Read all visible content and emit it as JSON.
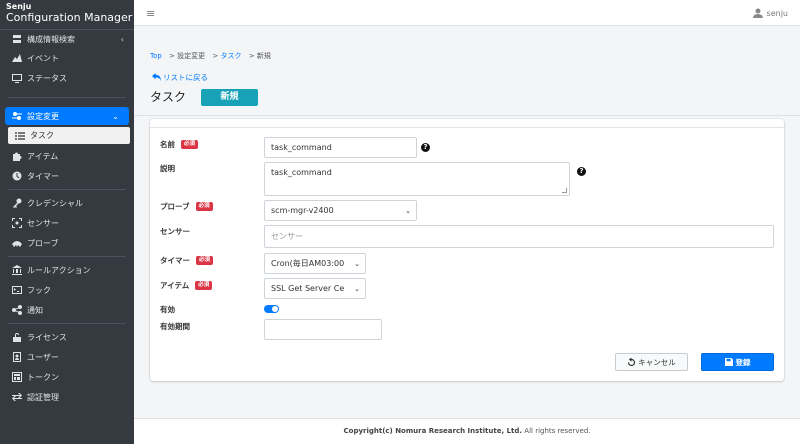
{
  "brand": {
    "line1": "Senju",
    "line2": "Configuration Manager"
  },
  "sidebar": {
    "items": [
      {
        "label": "構成情報検索",
        "icon": "server-icon",
        "caret": "‹"
      },
      {
        "label": "イベント",
        "icon": "chart-area-icon"
      },
      {
        "label": "ステータス",
        "icon": "monitor-icon"
      },
      {
        "label": "設定変更",
        "icon": "sliders-icon",
        "caret": "⌄"
      },
      {
        "label": "タスク",
        "icon": "list-icon"
      },
      {
        "label": "アイテム",
        "icon": "puzzle-icon"
      },
      {
        "label": "タイマー",
        "icon": "clock-icon"
      },
      {
        "label": "クレデンシャル",
        "icon": "key-icon"
      },
      {
        "label": "センサー",
        "icon": "scan-icon"
      },
      {
        "label": "プローブ",
        "icon": "probe-icon"
      },
      {
        "label": "ルールアクション",
        "icon": "bank-icon"
      },
      {
        "label": "フック",
        "icon": "terminal-icon"
      },
      {
        "label": "通知",
        "icon": "share-icon"
      },
      {
        "label": "ライセンス",
        "icon": "lock-open-icon"
      },
      {
        "label": "ユーザー",
        "icon": "user-book-icon"
      },
      {
        "label": "トークン",
        "icon": "token-icon"
      },
      {
        "label": "認証管理",
        "icon": "exchange-icon"
      }
    ]
  },
  "topbar": {
    "menu_icon": "≡",
    "username": "senju"
  },
  "breadcrumb": {
    "top": "Top",
    "sep": ">",
    "settings": "設定変更",
    "task": "タスク",
    "current": "新規"
  },
  "back_link": "リストに戻る",
  "page": {
    "title": "タスク",
    "badge": "新規"
  },
  "form": {
    "required_label": "必須",
    "name": {
      "label": "名前",
      "value": "task_command"
    },
    "description": {
      "label": "説明",
      "value": "task_command"
    },
    "probe": {
      "label": "プローブ",
      "value": "scm-mgr-v2400"
    },
    "sensor": {
      "label": "センサー",
      "placeholder": "センサー"
    },
    "timer": {
      "label": "タイマー",
      "value": "Cron(毎日AM03:00"
    },
    "item": {
      "label": "アイテム",
      "value": "SSL Get Server Ce"
    },
    "enabled": {
      "label": "有効",
      "on": true
    },
    "validity": {
      "label": "有効期間",
      "value": ""
    }
  },
  "buttons": {
    "cancel": "キャンセル",
    "save": "登録"
  },
  "footer": {
    "company": "Copyright(c) Nomura Research Institute, Ltd.",
    "rights": "All rights reserved."
  },
  "colors": {
    "accent": "#007bff",
    "badge": "#17a2b8",
    "required": "#dc3545",
    "sidebar_bg": "#343a40"
  }
}
